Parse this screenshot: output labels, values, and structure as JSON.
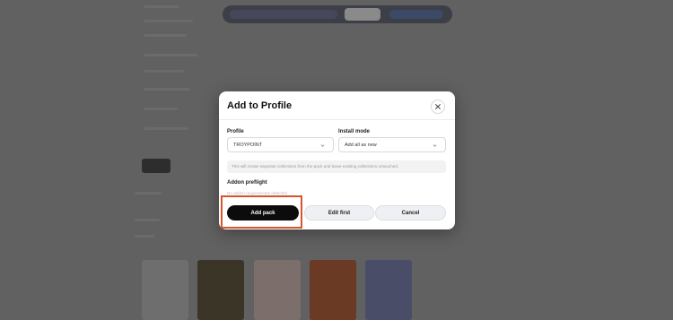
{
  "modal": {
    "title": "Add to Profile",
    "profile_label": "Profile",
    "profile_value": "TROYPOINT",
    "install_mode_label": "Install mode",
    "install_mode_value": "Add all as new",
    "info_text": "This will create separate collections from the pack and leave existing collections untouched.",
    "addon_preflight_label": "Addon preflight",
    "addon_preflight_note": "No addon requirements detected",
    "add_pack_label": "Add pack",
    "edit_first_label": "Edit first",
    "cancel_label": "Cancel"
  },
  "colors": {
    "primary_button": "#0c0c0c",
    "highlight": "#d9542b",
    "overlay": "#616161"
  }
}
